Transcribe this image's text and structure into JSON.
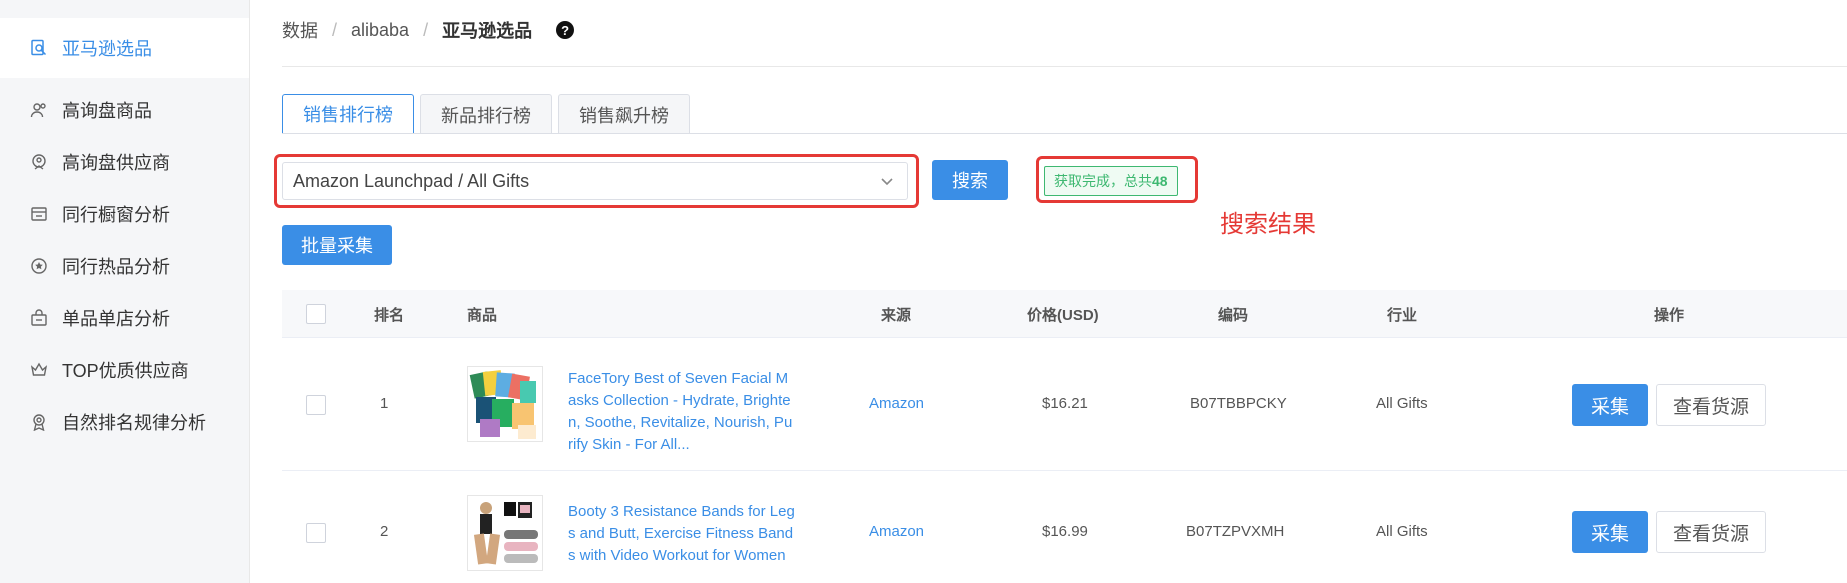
{
  "sidebar": {
    "items": [
      {
        "label": "亚马逊选品",
        "icon": "search-doc-icon",
        "active": true
      },
      {
        "label": "高询盘商品",
        "icon": "users-icon",
        "active": false
      },
      {
        "label": "高询盘供应商",
        "icon": "supplier-icon",
        "active": false
      },
      {
        "label": "同行橱窗分析",
        "icon": "shop-window-icon",
        "active": false
      },
      {
        "label": "同行热品分析",
        "icon": "star-circle-icon",
        "active": false
      },
      {
        "label": "单品单店分析",
        "icon": "store-bag-icon",
        "active": false
      },
      {
        "label": "TOP优质供应商",
        "icon": "crown-icon",
        "active": false
      },
      {
        "label": "自然排名规律分析",
        "icon": "award-icon",
        "active": false
      }
    ]
  },
  "breadcrumb": {
    "items": [
      "数据",
      "alibaba"
    ],
    "separator": "/",
    "current": "亚马逊选品"
  },
  "help_icon": "?",
  "tabs": [
    {
      "label": "销售排行榜",
      "active": true
    },
    {
      "label": "新品排行榜",
      "active": false
    },
    {
      "label": "销售飙升榜",
      "active": false
    }
  ],
  "search": {
    "selected_category": "Amazon Launchpad / All Gifts",
    "button_label": "搜索",
    "status_text": "获取完成，总共",
    "status_count": "48",
    "annotation": "搜索结果"
  },
  "bulk_button_label": "批量采集",
  "table": {
    "headers": {
      "rank": "排名",
      "product": "商品",
      "source": "来源",
      "price": "价格(USD)",
      "code": "编码",
      "industry": "行业",
      "actions": "操作"
    },
    "rows": [
      {
        "rank": "1",
        "title": "FaceTory Best of Seven Facial Masks Collection - Hydrate, Brighten, Soothe, Revitalize, Nourish, Purify Skin - For All...",
        "source": "Amazon",
        "price": "$16.21",
        "code": "B07TBBPCKY",
        "industry": "All Gifts",
        "collect_label": "采集",
        "view_label": "查看货源"
      },
      {
        "rank": "2",
        "title": "Booty 3 Resistance Bands for Legs and Butt, Exercise Fitness Bands with Video Workout for Women",
        "source": "Amazon",
        "price": "$16.99",
        "code": "B07TZPVXMH",
        "industry": "All Gifts",
        "collect_label": "采集",
        "view_label": "查看货源"
      }
    ]
  },
  "colors": {
    "primary": "#3a8ee6",
    "success": "#3eb871",
    "annotation_red": "#e53935"
  }
}
